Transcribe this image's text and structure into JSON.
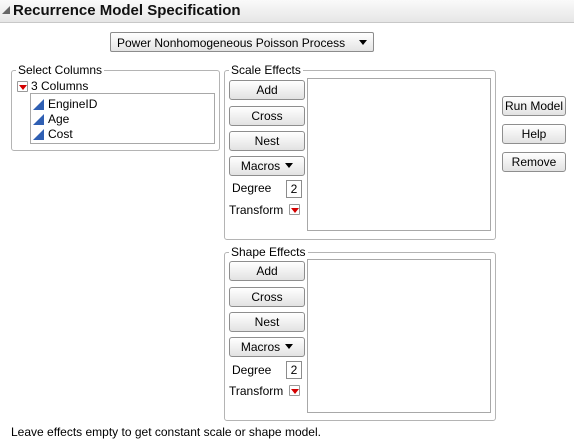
{
  "window": {
    "title": "Recurrence Model Specification"
  },
  "model_dropdown": {
    "selected": "Power Nonhomogeneous Poisson Process"
  },
  "select_columns": {
    "title": "Select Columns",
    "count_label": "3 Columns",
    "columns": [
      "EngineID",
      "Age",
      "Cost"
    ]
  },
  "scale_effects": {
    "title": "Scale Effects",
    "add_label": "Add",
    "cross_label": "Cross",
    "nest_label": "Nest",
    "macros_label": "Macros",
    "degree_label": "Degree",
    "degree_value": "2",
    "transform_label": "Transform"
  },
  "shape_effects": {
    "title": "Shape Effects",
    "add_label": "Add",
    "cross_label": "Cross",
    "nest_label": "Nest",
    "macros_label": "Macros",
    "degree_label": "Degree",
    "degree_value": "2",
    "transform_label": "Transform"
  },
  "actions": {
    "run_model_label": "Run Model",
    "help_label": "Help",
    "remove_label": "Remove"
  },
  "footer": {
    "note": "Leave effects empty to get constant scale or shape model."
  },
  "colors": {
    "red_triangle": "#d40000",
    "column_icon": "#2f5fb3"
  }
}
